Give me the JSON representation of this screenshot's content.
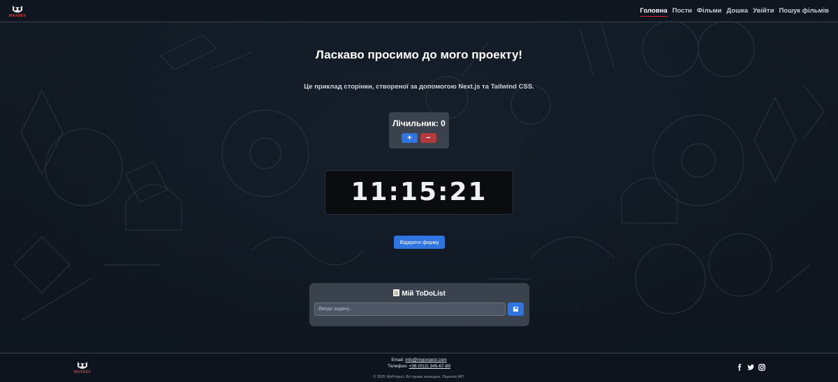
{
  "brand": {
    "logo_text": "MAXDEV",
    "logo_icon": "owl-icon"
  },
  "nav": {
    "items": [
      {
        "label": "Головна",
        "active": true
      },
      {
        "label": "Пости",
        "active": false
      },
      {
        "label": "Фільми",
        "active": false
      },
      {
        "label": "Дошка",
        "active": false
      },
      {
        "label": "Увійти",
        "active": false
      },
      {
        "label": "Пошук фільмів",
        "active": false
      }
    ]
  },
  "hero": {
    "title": "Ласкаво просимо до мого проекту!",
    "subtitle": "Це приклад сторінки, створеної за допомогою Next.js та Tailwind CSS."
  },
  "counter": {
    "label": "Лічильник: 0",
    "plus_label": "+",
    "minus_label": "−"
  },
  "clock": {
    "time": "11:15:21"
  },
  "open_form": {
    "label": "Відкрити форму"
  },
  "todo": {
    "title": "Мій ToDoList",
    "title_icon": "memo-icon",
    "input_placeholder": "Введи задачу...",
    "add_icon": "save-icon"
  },
  "footer": {
    "email_label": "Email:",
    "email": "info@myproject.com",
    "phone_label": "Телефон:",
    "phone": "+38 (012) 345-67-89",
    "copyright": "© 2025 MyProject. Всі права захищені. Ліцензія MIT.",
    "socials": [
      "facebook-icon",
      "twitter-icon",
      "instagram-icon"
    ]
  },
  "colors": {
    "background": "#0f161f",
    "accent_blue": "#2f74e0",
    "accent_red": "#b23a3c",
    "active_underline": "#e11d2c",
    "card": "#3a424e"
  }
}
